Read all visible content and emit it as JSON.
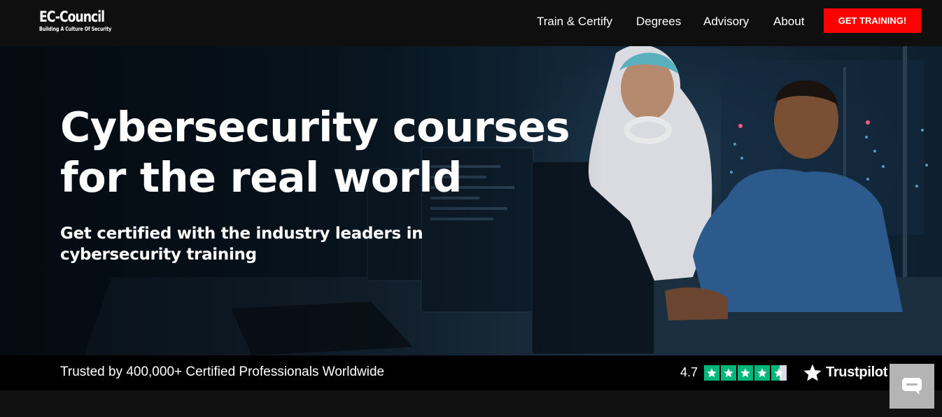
{
  "header": {
    "logo_name": "EC-Council",
    "logo_tagline": "Building A Culture Of Security",
    "nav": [
      {
        "label": "Train & Certify"
      },
      {
        "label": "Degrees"
      },
      {
        "label": "Advisory"
      },
      {
        "label": "About"
      }
    ],
    "cta_label": "GET TRAINING!"
  },
  "hero": {
    "title_line1": "Cybersecurity courses",
    "title_line2": "for the real world",
    "subtitle_line1": "Get certified with the industry leaders in",
    "subtitle_line2": "cybersecurity training"
  },
  "trust": {
    "text": "Trusted by 400,000+ Certified Professionals Worldwide",
    "rating": "4.7",
    "stars": 4.5,
    "provider": "Trustpilot"
  },
  "icons": {
    "chat": "chat-bubble-icon",
    "trustpilot_star": "star-icon"
  },
  "colors": {
    "cta": "#ff0000",
    "trustpilot_green": "#00b67a",
    "nav_bg": "#0f0f0f"
  }
}
